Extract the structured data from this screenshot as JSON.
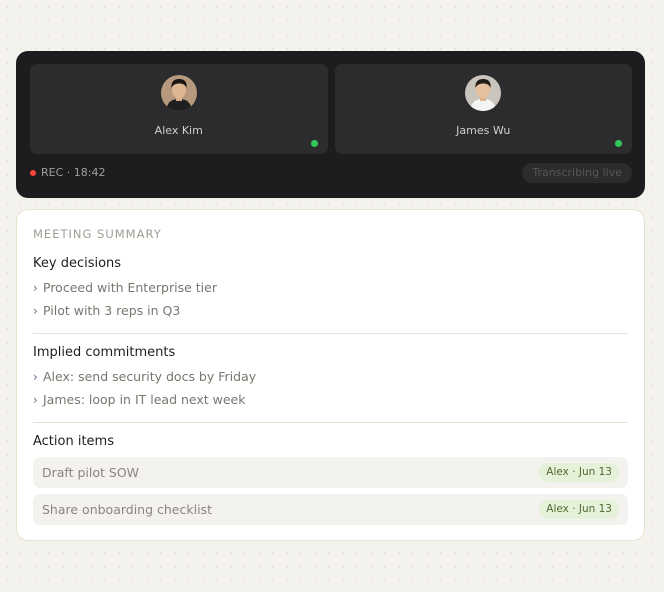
{
  "call": {
    "participants": [
      {
        "name": "Alex Kim"
      },
      {
        "name": "James Wu"
      }
    ],
    "rec_label": "REC · 18:42",
    "transcribing_label": "Transcribing live",
    "colors": {
      "live": "#34c759",
      "rec": "#ff453a"
    }
  },
  "summary": {
    "title": "MEETING SUMMARY",
    "key_decisions": {
      "heading": "Key decisions",
      "items": [
        "Proceed with Enterprise tier",
        "Pilot with 3 reps in Q3"
      ]
    },
    "implied_commitments": {
      "heading": "Implied commitments",
      "items": [
        "Alex: send security docs by Friday",
        "James: loop in IT lead next week"
      ]
    },
    "action_items": {
      "heading": "Action items",
      "items": [
        {
          "label": "Draft pilot SOW",
          "tag": "Alex · Jun 13"
        },
        {
          "label": "Share onboarding checklist",
          "tag": "Alex · Jun 13"
        }
      ]
    }
  }
}
